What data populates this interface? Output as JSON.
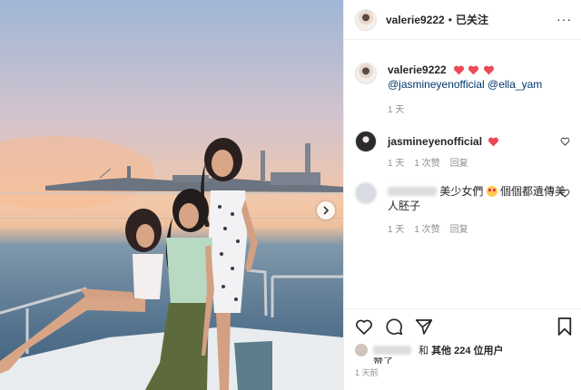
{
  "header": {
    "username": "valerie9222",
    "separator": "•",
    "follow_status": "已关注",
    "more": "···"
  },
  "caption": {
    "username": "valerie9222",
    "mention_1": "@jasmineyenofficial",
    "mention_2": "@ella_yam",
    "time": "1 天"
  },
  "comments": [
    {
      "username": "jasmineyenofficial",
      "time": "1 天",
      "likes": "1 次赞",
      "reply": "回复"
    },
    {
      "text_1": "美少女們",
      "text_2": "個個都遺傳美人胚子",
      "time": "1 天",
      "likes": "1 次赞",
      "reply": "回复"
    }
  ],
  "likes": {
    "and": "和",
    "others": "其他 224 位用户",
    "trunc": "赞了"
  },
  "posted": "1 天前",
  "icons": [
    "heart-icon",
    "comment-icon",
    "share-icon",
    "bookmark-icon",
    "chevron-right-icon"
  ],
  "colors": {
    "red_heart": "#ed4956",
    "mention": "#00376b",
    "meta": "#8e8e8e"
  }
}
